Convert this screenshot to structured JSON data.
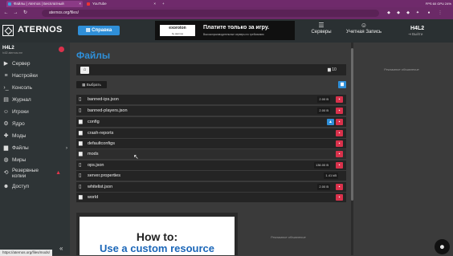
{
  "browser": {
    "tabs": [
      {
        "label": "Файлы | Aternos | Бесплатный",
        "active": true
      },
      {
        "label": "YouTube",
        "active": false
      }
    ],
    "new_tab": "+",
    "url": "aternos.org/files/",
    "system_tray": "FPS 60 GPU 24%"
  },
  "header": {
    "logo": "ATERNOS",
    "help_button": "Справка",
    "ad": {
      "brand": "exoroton",
      "brand_sub": "by aternos",
      "title": "Платите только за игру.",
      "subtitle": "Высокопроизводительные серверы по требованию"
    },
    "servers_label": "Серверы",
    "account_label": "Учетная Запись",
    "user_name": "H4L2",
    "user_status": "Выйти"
  },
  "sidebar": {
    "server_name": "H4L2",
    "server_address": "h4l2.aternos.me",
    "items": [
      {
        "label": "Сервер",
        "icon": "play-icon"
      },
      {
        "label": "Настройки",
        "icon": "sliders-icon"
      },
      {
        "label": "Консоль",
        "icon": "terminal-icon"
      },
      {
        "label": "Журнал",
        "icon": "log-icon"
      },
      {
        "label": "Игроки",
        "icon": "players-icon"
      },
      {
        "label": "Ядро",
        "icon": "core-icon"
      },
      {
        "label": "Моды",
        "icon": "puzzle-icon"
      },
      {
        "label": "Файлы",
        "icon": "folder-icon"
      },
      {
        "label": "Миры",
        "icon": "globe-icon"
      },
      {
        "label": "Резервные копии",
        "icon": "backup-icon"
      },
      {
        "label": "Доступ",
        "icon": "users-icon"
      }
    ],
    "collapse": "«"
  },
  "files": {
    "title": "Файлы",
    "folder_count": "10",
    "select_button": "Выбрать",
    "rows": [
      {
        "name": "banned-ips.json",
        "type": "file",
        "size": "2.00 B"
      },
      {
        "name": "banned-players.json",
        "type": "file",
        "size": "2.00 B"
      },
      {
        "name": "config",
        "type": "folder",
        "size": ""
      },
      {
        "name": "crash-reports",
        "type": "folder",
        "size": ""
      },
      {
        "name": "defaultconfigs",
        "type": "folder",
        "size": ""
      },
      {
        "name": "mods",
        "type": "folder",
        "size": ""
      },
      {
        "name": "ops.json",
        "type": "file",
        "size": "136.00 B"
      },
      {
        "name": "server.properties",
        "type": "file",
        "size": "1.41 kB"
      },
      {
        "name": "whitelist.json",
        "type": "file",
        "size": "2.00 B"
      },
      {
        "name": "world",
        "type": "folder",
        "size": ""
      }
    ]
  },
  "promo": {
    "line1": "How to:",
    "line2": "Use a custom resource"
  },
  "ads": {
    "label": "Рекламное объявление"
  },
  "status_bar": {
    "url": "https://aternos.org/files/mods/"
  },
  "colors": {
    "accent": "#2f8fd8",
    "danger": "#d9314b",
    "browser": "#6f2a6b"
  }
}
